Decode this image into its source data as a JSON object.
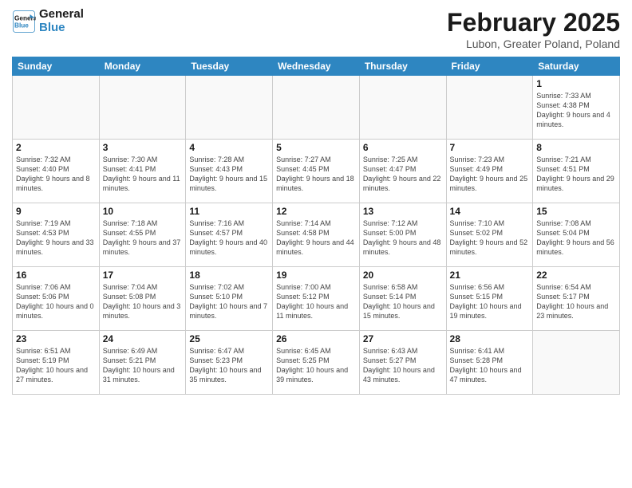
{
  "header": {
    "logo_line1": "General",
    "logo_line2": "Blue",
    "main_title": "February 2025",
    "subtitle": "Lubon, Greater Poland, Poland"
  },
  "weekdays": [
    "Sunday",
    "Monday",
    "Tuesday",
    "Wednesday",
    "Thursday",
    "Friday",
    "Saturday"
  ],
  "weeks": [
    [
      {
        "day": "",
        "info": ""
      },
      {
        "day": "",
        "info": ""
      },
      {
        "day": "",
        "info": ""
      },
      {
        "day": "",
        "info": ""
      },
      {
        "day": "",
        "info": ""
      },
      {
        "day": "",
        "info": ""
      },
      {
        "day": "1",
        "info": "Sunrise: 7:33 AM\nSunset: 4:38 PM\nDaylight: 9 hours and 4 minutes."
      }
    ],
    [
      {
        "day": "2",
        "info": "Sunrise: 7:32 AM\nSunset: 4:40 PM\nDaylight: 9 hours and 8 minutes."
      },
      {
        "day": "3",
        "info": "Sunrise: 7:30 AM\nSunset: 4:41 PM\nDaylight: 9 hours and 11 minutes."
      },
      {
        "day": "4",
        "info": "Sunrise: 7:28 AM\nSunset: 4:43 PM\nDaylight: 9 hours and 15 minutes."
      },
      {
        "day": "5",
        "info": "Sunrise: 7:27 AM\nSunset: 4:45 PM\nDaylight: 9 hours and 18 minutes."
      },
      {
        "day": "6",
        "info": "Sunrise: 7:25 AM\nSunset: 4:47 PM\nDaylight: 9 hours and 22 minutes."
      },
      {
        "day": "7",
        "info": "Sunrise: 7:23 AM\nSunset: 4:49 PM\nDaylight: 9 hours and 25 minutes."
      },
      {
        "day": "8",
        "info": "Sunrise: 7:21 AM\nSunset: 4:51 PM\nDaylight: 9 hours and 29 minutes."
      }
    ],
    [
      {
        "day": "9",
        "info": "Sunrise: 7:19 AM\nSunset: 4:53 PM\nDaylight: 9 hours and 33 minutes."
      },
      {
        "day": "10",
        "info": "Sunrise: 7:18 AM\nSunset: 4:55 PM\nDaylight: 9 hours and 37 minutes."
      },
      {
        "day": "11",
        "info": "Sunrise: 7:16 AM\nSunset: 4:57 PM\nDaylight: 9 hours and 40 minutes."
      },
      {
        "day": "12",
        "info": "Sunrise: 7:14 AM\nSunset: 4:58 PM\nDaylight: 9 hours and 44 minutes."
      },
      {
        "day": "13",
        "info": "Sunrise: 7:12 AM\nSunset: 5:00 PM\nDaylight: 9 hours and 48 minutes."
      },
      {
        "day": "14",
        "info": "Sunrise: 7:10 AM\nSunset: 5:02 PM\nDaylight: 9 hours and 52 minutes."
      },
      {
        "day": "15",
        "info": "Sunrise: 7:08 AM\nSunset: 5:04 PM\nDaylight: 9 hours and 56 minutes."
      }
    ],
    [
      {
        "day": "16",
        "info": "Sunrise: 7:06 AM\nSunset: 5:06 PM\nDaylight: 10 hours and 0 minutes."
      },
      {
        "day": "17",
        "info": "Sunrise: 7:04 AM\nSunset: 5:08 PM\nDaylight: 10 hours and 3 minutes."
      },
      {
        "day": "18",
        "info": "Sunrise: 7:02 AM\nSunset: 5:10 PM\nDaylight: 10 hours and 7 minutes."
      },
      {
        "day": "19",
        "info": "Sunrise: 7:00 AM\nSunset: 5:12 PM\nDaylight: 10 hours and 11 minutes."
      },
      {
        "day": "20",
        "info": "Sunrise: 6:58 AM\nSunset: 5:14 PM\nDaylight: 10 hours and 15 minutes."
      },
      {
        "day": "21",
        "info": "Sunrise: 6:56 AM\nSunset: 5:15 PM\nDaylight: 10 hours and 19 minutes."
      },
      {
        "day": "22",
        "info": "Sunrise: 6:54 AM\nSunset: 5:17 PM\nDaylight: 10 hours and 23 minutes."
      }
    ],
    [
      {
        "day": "23",
        "info": "Sunrise: 6:51 AM\nSunset: 5:19 PM\nDaylight: 10 hours and 27 minutes."
      },
      {
        "day": "24",
        "info": "Sunrise: 6:49 AM\nSunset: 5:21 PM\nDaylight: 10 hours and 31 minutes."
      },
      {
        "day": "25",
        "info": "Sunrise: 6:47 AM\nSunset: 5:23 PM\nDaylight: 10 hours and 35 minutes."
      },
      {
        "day": "26",
        "info": "Sunrise: 6:45 AM\nSunset: 5:25 PM\nDaylight: 10 hours and 39 minutes."
      },
      {
        "day": "27",
        "info": "Sunrise: 6:43 AM\nSunset: 5:27 PM\nDaylight: 10 hours and 43 minutes."
      },
      {
        "day": "28",
        "info": "Sunrise: 6:41 AM\nSunset: 5:28 PM\nDaylight: 10 hours and 47 minutes."
      },
      {
        "day": "",
        "info": ""
      }
    ]
  ]
}
